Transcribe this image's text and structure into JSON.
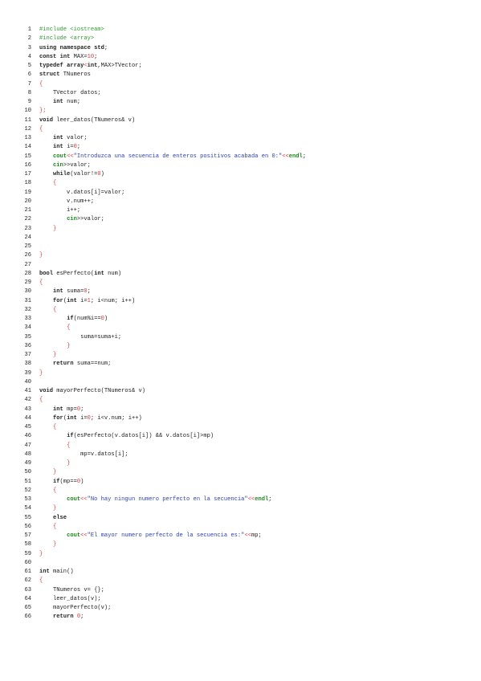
{
  "colors": {
    "keyword": "#111111",
    "preprocessor": "#2e9a2e",
    "string": "#2a3fb0",
    "number": "#d23a3a",
    "stream": "#1c8a1c",
    "text": "#222222"
  },
  "lines": [
    [
      {
        "t": "#include <iostream>",
        "c": "pp"
      }
    ],
    [
      {
        "t": "#include <array>",
        "c": "pp"
      }
    ],
    [
      {
        "t": "using",
        "c": "kw"
      },
      {
        "t": " "
      },
      {
        "t": "namespace",
        "c": "kw"
      },
      {
        "t": " "
      },
      {
        "t": "std",
        "c": "kw"
      },
      {
        "t": ";"
      }
    ],
    [
      {
        "t": "const",
        "c": "kw"
      },
      {
        "t": " "
      },
      {
        "t": "int",
        "c": "kw"
      },
      {
        "t": " MAX="
      },
      {
        "t": "10",
        "c": "num"
      },
      {
        "t": ";"
      }
    ],
    [
      {
        "t": "typedef",
        "c": "kw"
      },
      {
        "t": " "
      },
      {
        "t": "array",
        "c": "kw"
      },
      {
        "t": "<",
        "c": "br"
      },
      {
        "t": "int",
        "c": "kw"
      },
      {
        "t": ",MAX>TVector;"
      }
    ],
    [
      {
        "t": "struct",
        "c": "kw"
      },
      {
        "t": " TNumeros"
      }
    ],
    [
      {
        "t": "{",
        "c": "br"
      }
    ],
    [
      {
        "t": "    TVector datos;"
      }
    ],
    [
      {
        "t": "    "
      },
      {
        "t": "int",
        "c": "kw"
      },
      {
        "t": " num;"
      }
    ],
    [
      {
        "t": "};",
        "c": "br"
      }
    ],
    [
      {
        "t": "void",
        "c": "kw"
      },
      {
        "t": " leer_datos(TNumeros& v)"
      }
    ],
    [
      {
        "t": "{",
        "c": "br"
      }
    ],
    [
      {
        "t": "    "
      },
      {
        "t": "int",
        "c": "kw"
      },
      {
        "t": " valor;"
      }
    ],
    [
      {
        "t": "    "
      },
      {
        "t": "int",
        "c": "kw"
      },
      {
        "t": " i="
      },
      {
        "t": "0",
        "c": "num"
      },
      {
        "t": ";"
      }
    ],
    [
      {
        "t": "    "
      },
      {
        "t": "cout",
        "c": "io"
      },
      {
        "t": "<<",
        "c": "br"
      },
      {
        "t": "\"Introduzca una secuencia de enteros positivos acabada en 0:\"",
        "c": "str"
      },
      {
        "t": "<<",
        "c": "br"
      },
      {
        "t": "endl",
        "c": "io"
      },
      {
        "t": ";"
      }
    ],
    [
      {
        "t": "    "
      },
      {
        "t": "cin",
        "c": "io"
      },
      {
        "t": ">>valor;"
      }
    ],
    [
      {
        "t": "    "
      },
      {
        "t": "while",
        "c": "kw"
      },
      {
        "t": "(valor!="
      },
      {
        "t": "0",
        "c": "num"
      },
      {
        "t": ")"
      }
    ],
    [
      {
        "t": "    "
      },
      {
        "t": "{",
        "c": "br"
      }
    ],
    [
      {
        "t": "        v.datos[i]=valor;"
      }
    ],
    [
      {
        "t": "        v.num++;"
      }
    ],
    [
      {
        "t": "        i++;"
      }
    ],
    [
      {
        "t": "        "
      },
      {
        "t": "cin",
        "c": "io"
      },
      {
        "t": ">>valor;"
      }
    ],
    [
      {
        "t": "    "
      },
      {
        "t": "}",
        "c": "br"
      }
    ],
    [],
    [],
    [
      {
        "t": "}",
        "c": "br"
      }
    ],
    [],
    [
      {
        "t": "bool",
        "c": "kw"
      },
      {
        "t": " esPerfecto("
      },
      {
        "t": "int",
        "c": "kw"
      },
      {
        "t": " num)"
      }
    ],
    [
      {
        "t": "{",
        "c": "br"
      }
    ],
    [
      {
        "t": "    "
      },
      {
        "t": "int",
        "c": "kw"
      },
      {
        "t": " suma="
      },
      {
        "t": "0",
        "c": "num"
      },
      {
        "t": ";"
      }
    ],
    [
      {
        "t": "    "
      },
      {
        "t": "for",
        "c": "kw"
      },
      {
        "t": "("
      },
      {
        "t": "int",
        "c": "kw"
      },
      {
        "t": " i="
      },
      {
        "t": "1",
        "c": "num"
      },
      {
        "t": "; i<num; i++)"
      }
    ],
    [
      {
        "t": "    "
      },
      {
        "t": "{",
        "c": "br"
      }
    ],
    [
      {
        "t": "        "
      },
      {
        "t": "if",
        "c": "kw"
      },
      {
        "t": "(num%i=="
      },
      {
        "t": "0",
        "c": "num"
      },
      {
        "t": ")"
      }
    ],
    [
      {
        "t": "        "
      },
      {
        "t": "{",
        "c": "br"
      }
    ],
    [
      {
        "t": "            suma=suma+i;"
      }
    ],
    [
      {
        "t": "        "
      },
      {
        "t": "}",
        "c": "br"
      }
    ],
    [
      {
        "t": "    "
      },
      {
        "t": "}",
        "c": "br"
      }
    ],
    [
      {
        "t": "    "
      },
      {
        "t": "return",
        "c": "kw"
      },
      {
        "t": " suma==num;"
      }
    ],
    [
      {
        "t": "}",
        "c": "br"
      }
    ],
    [],
    [
      {
        "t": "void",
        "c": "kw"
      },
      {
        "t": " mayorPerfecto(TNumeros& v)"
      }
    ],
    [
      {
        "t": "{",
        "c": "br"
      }
    ],
    [
      {
        "t": "    "
      },
      {
        "t": "int",
        "c": "kw"
      },
      {
        "t": " mp="
      },
      {
        "t": "0",
        "c": "num"
      },
      {
        "t": ";"
      }
    ],
    [
      {
        "t": "    "
      },
      {
        "t": "for",
        "c": "kw"
      },
      {
        "t": "("
      },
      {
        "t": "int",
        "c": "kw"
      },
      {
        "t": " i="
      },
      {
        "t": "0",
        "c": "num"
      },
      {
        "t": "; i<v.num; i++)"
      }
    ],
    [
      {
        "t": "    "
      },
      {
        "t": "{",
        "c": "br"
      }
    ],
    [
      {
        "t": "        "
      },
      {
        "t": "if",
        "c": "kw"
      },
      {
        "t": "(esPerfecto(v.datos[i]) && v.datos[i]>mp)"
      }
    ],
    [
      {
        "t": "        "
      },
      {
        "t": "{",
        "c": "br"
      }
    ],
    [
      {
        "t": "            mp=v.datos[i];"
      }
    ],
    [
      {
        "t": "        "
      },
      {
        "t": "}",
        "c": "br"
      }
    ],
    [
      {
        "t": "    "
      },
      {
        "t": "}",
        "c": "br"
      }
    ],
    [
      {
        "t": "    "
      },
      {
        "t": "if",
        "c": "kw"
      },
      {
        "t": "(mp=="
      },
      {
        "t": "0",
        "c": "num"
      },
      {
        "t": ")"
      }
    ],
    [
      {
        "t": "    "
      },
      {
        "t": "{",
        "c": "br"
      }
    ],
    [
      {
        "t": "        "
      },
      {
        "t": "cout",
        "c": "io"
      },
      {
        "t": "<<",
        "c": "br"
      },
      {
        "t": "\"No hay ningun numero perfecto en la secuencia\"",
        "c": "str"
      },
      {
        "t": "<<",
        "c": "br"
      },
      {
        "t": "endl",
        "c": "io"
      },
      {
        "t": ";"
      }
    ],
    [
      {
        "t": "    "
      },
      {
        "t": "}",
        "c": "br"
      }
    ],
    [
      {
        "t": "    "
      },
      {
        "t": "else",
        "c": "kw"
      }
    ],
    [
      {
        "t": "    "
      },
      {
        "t": "{",
        "c": "br"
      }
    ],
    [
      {
        "t": "        "
      },
      {
        "t": "cout",
        "c": "io"
      },
      {
        "t": "<<",
        "c": "br"
      },
      {
        "t": "\"El mayor numero perfecto de la secuencia es:\"",
        "c": "str"
      },
      {
        "t": "<<",
        "c": "br"
      },
      {
        "t": "mp;"
      }
    ],
    [
      {
        "t": "    "
      },
      {
        "t": "}",
        "c": "br"
      }
    ],
    [
      {
        "t": "}",
        "c": "br"
      }
    ],
    [],
    [
      {
        "t": "int",
        "c": "kw"
      },
      {
        "t": " main()"
      }
    ],
    [
      {
        "t": "{",
        "c": "br"
      }
    ],
    [
      {
        "t": "    TNumeros v= {};"
      }
    ],
    [
      {
        "t": "    leer_datos(v);"
      }
    ],
    [
      {
        "t": "    mayorPerfecto(v);"
      }
    ],
    [
      {
        "t": "    "
      },
      {
        "t": "return",
        "c": "kw"
      },
      {
        "t": " "
      },
      {
        "t": "0",
        "c": "num"
      },
      {
        "t": ";"
      }
    ]
  ]
}
